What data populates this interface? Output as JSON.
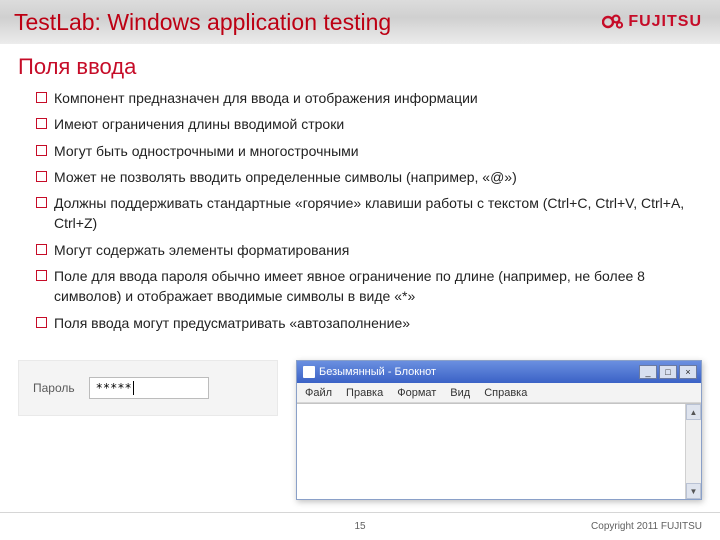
{
  "header": {
    "title": "TestLab: Windows application testing",
    "logo_word": "FUJITSU"
  },
  "section": {
    "heading": "Поля ввода",
    "bullets": [
      "Компонент предназначен для ввода и отображения информации",
      "Имеют ограничения длины вводимой строки",
      "Могут быть однострочными и многострочными",
      "Может не позволять вводить определенные символы (например, «@»)",
      "Должны поддерживать стандартные «горячие» клавиши работы с текстом (Ctrl+C, Ctrl+V, Ctrl+A, Ctrl+Z)",
      "Могут содержать элементы форматирования",
      "Поле для ввода пароля обычно имеет явное ограничение по длине (например, не более 8 символов) и отображает вводимые символы в виде «*»",
      "Поля ввода могут предусматривать «автозаполнение»"
    ]
  },
  "password_illustration": {
    "label": "Пароль",
    "value": "*****"
  },
  "notepad": {
    "title": "Безымянный - Блокнот",
    "menu": [
      "Файл",
      "Правка",
      "Формат",
      "Вид",
      "Справка"
    ],
    "controls": {
      "min": "_",
      "max": "□",
      "close": "×"
    }
  },
  "footer": {
    "page": "15",
    "copyright": "Copyright 2011 FUJITSU"
  }
}
